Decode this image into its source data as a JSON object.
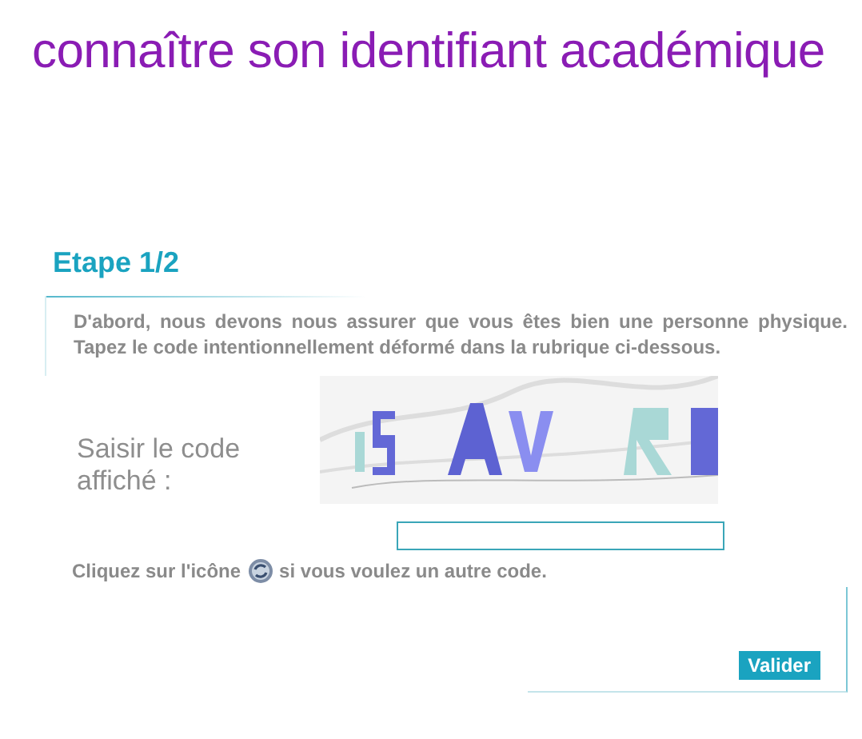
{
  "title": "connaître son identifiant académique",
  "step": {
    "heading": "Etape 1/2",
    "intro": "D'abord, nous devons nous assurer que vous êtes bien une personne physique. Tapez le code intentionnellement déformé dans la rubrique ci-dessous."
  },
  "captcha": {
    "label": "Saisir le code affiché :",
    "help_before": "Cliquez sur l'icône",
    "help_after": "si vous voulez un autre code."
  },
  "buttons": [
    {
      "label": "Valider"
    }
  ]
}
